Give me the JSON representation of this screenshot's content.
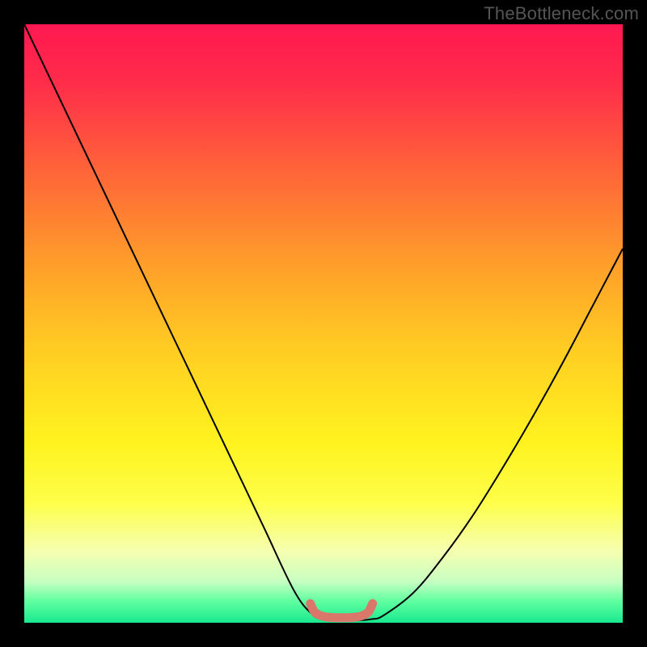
{
  "watermark": "TheBottleneck.com",
  "chart_data": {
    "type": "line",
    "title": "",
    "xlabel": "",
    "ylabel": "",
    "xlim": [
      0,
      100
    ],
    "ylim": [
      0,
      100
    ],
    "grid": false,
    "series": [
      {
        "name": "bottleneck-curve",
        "x": [
          0,
          5,
          10,
          15,
          20,
          25,
          30,
          35,
          40,
          45,
          48,
          50,
          52,
          54,
          56,
          58,
          60,
          65,
          70,
          75,
          80,
          85,
          90,
          95,
          100
        ],
        "y": [
          100,
          89.5,
          79,
          68.5,
          58,
          47.5,
          37,
          26.5,
          16,
          5.5,
          1.5,
          0.5,
          0.3,
          0.3,
          0.4,
          0.6,
          1.2,
          5,
          11,
          18,
          26,
          34.5,
          43.5,
          53,
          62.5
        ],
        "color": "#000000"
      },
      {
        "name": "optimal-zone-marker",
        "x": [
          47.8,
          48.5,
          49.5,
          51,
          53,
          55,
          56.5,
          57.5,
          58.2
        ],
        "y": [
          3.2,
          1.8,
          1.2,
          0.9,
          0.85,
          0.9,
          1.2,
          1.8,
          3.2
        ],
        "color": "#d9776b"
      }
    ],
    "background_gradient": {
      "stops": [
        {
          "offset": 0.0,
          "color": "#ff1850"
        },
        {
          "offset": 0.1,
          "color": "#ff2d4a"
        },
        {
          "offset": 0.25,
          "color": "#ff6638"
        },
        {
          "offset": 0.4,
          "color": "#ff9e2a"
        },
        {
          "offset": 0.55,
          "color": "#ffcf22"
        },
        {
          "offset": 0.7,
          "color": "#fff31f"
        },
        {
          "offset": 0.8,
          "color": "#feff4a"
        },
        {
          "offset": 0.88,
          "color": "#f6ffb0"
        },
        {
          "offset": 0.93,
          "color": "#c9ffc2"
        },
        {
          "offset": 0.965,
          "color": "#5effa0"
        },
        {
          "offset": 1.0,
          "color": "#18e88e"
        }
      ]
    }
  }
}
